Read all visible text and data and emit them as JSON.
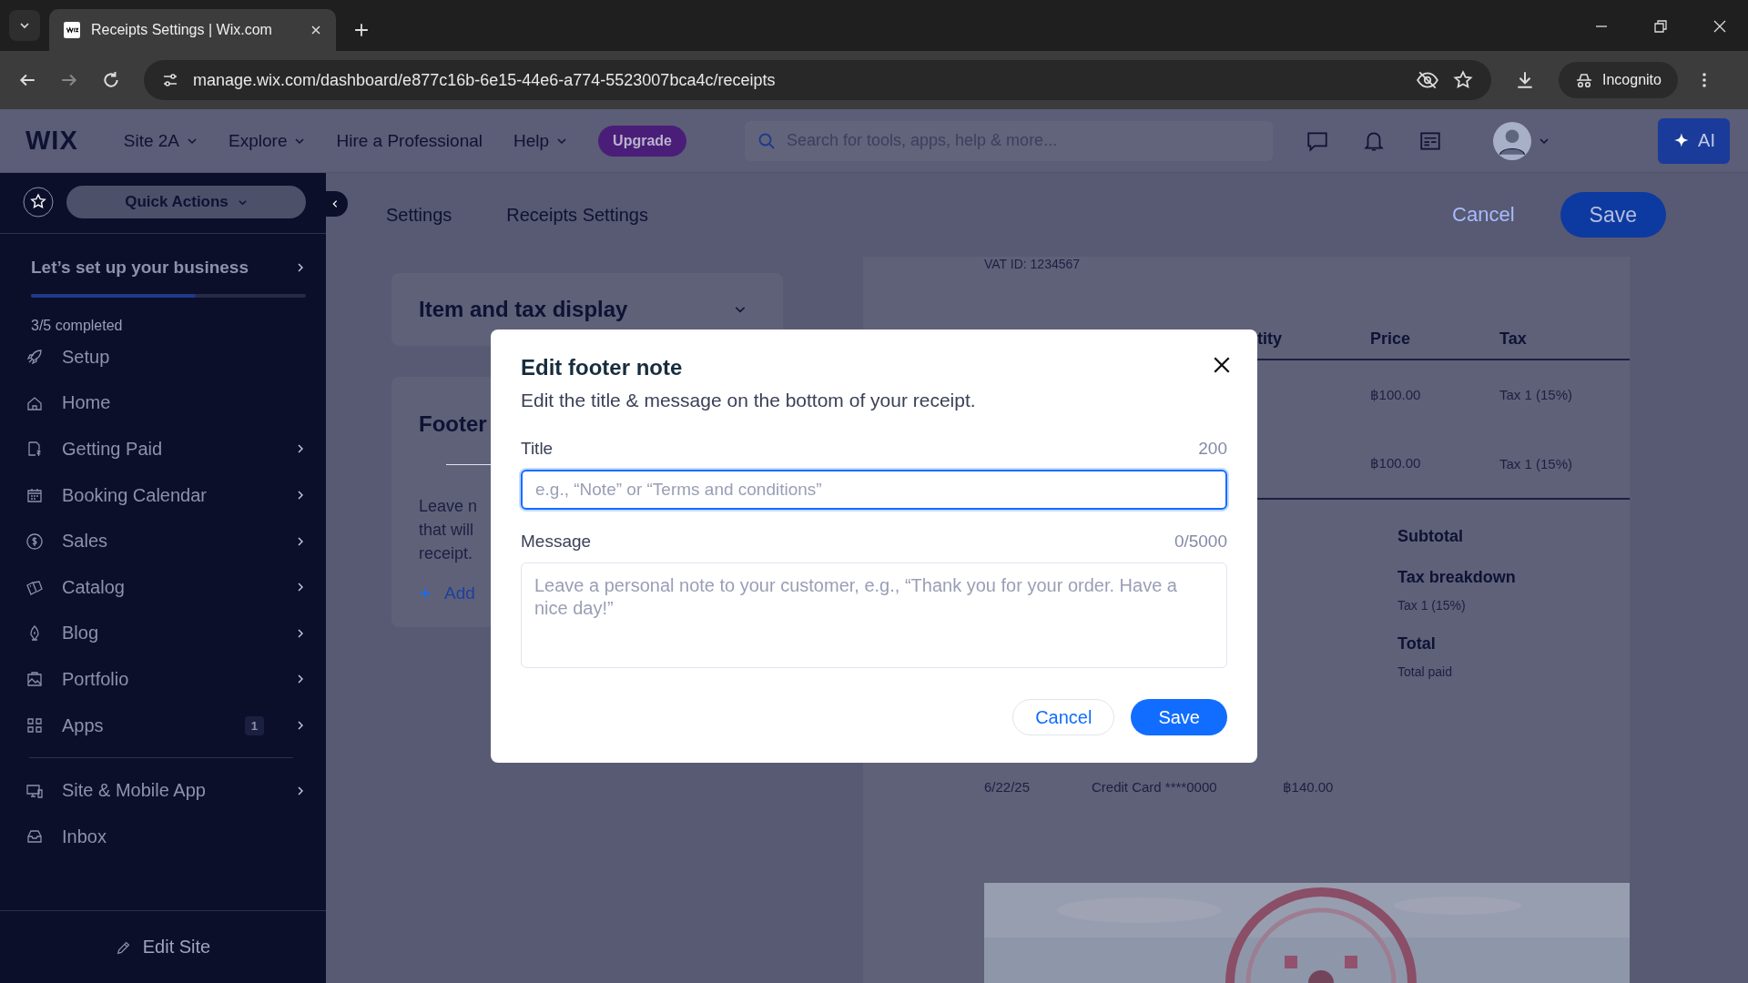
{
  "browser": {
    "tab_title": "Receipts Settings | Wix.com",
    "url": "manage.wix.com/dashboard/e877c16b-6e15-44e6-a774-5523007bca4c/receipts",
    "profile": "Incognito"
  },
  "topbar": {
    "logo": "WIX",
    "menus": [
      {
        "label": "Site 2A",
        "dropdown": true
      },
      {
        "label": "Explore",
        "dropdown": true
      },
      {
        "label": "Hire a Professional",
        "dropdown": false
      },
      {
        "label": "Help",
        "dropdown": true
      }
    ],
    "upgrade": "Upgrade",
    "search": {
      "placeholder": "Search for tools, apps, help & more..."
    },
    "ai": "AI"
  },
  "sidebar": {
    "quick_actions": "Quick Actions",
    "setup": {
      "title": "Let’s set up your business",
      "level": 0.6,
      "progress": "3/5 completed"
    },
    "items": [
      {
        "label": "Setup",
        "arrow": false
      },
      {
        "label": "Home",
        "arrow": false
      },
      {
        "label": "Getting Paid",
        "arrow": true
      },
      {
        "label": "Booking Calendar",
        "arrow": true
      },
      {
        "label": "Sales",
        "arrow": true
      },
      {
        "label": "Catalog",
        "arrow": true
      },
      {
        "label": "Blog",
        "arrow": true
      },
      {
        "label": "Portfolio",
        "arrow": true
      },
      {
        "label": "Apps",
        "arrow": true,
        "badge": "1"
      }
    ],
    "items_secondary": [
      {
        "label": "Site & Mobile App",
        "arrow": true
      },
      {
        "label": "Inbox",
        "arrow": false
      }
    ],
    "edit_site": "Edit Site"
  },
  "page": {
    "breadcrumbs": [
      "Settings",
      "Receipts Settings"
    ],
    "cancel": "Cancel",
    "save": "Save",
    "sections": [
      {
        "title": "Item and tax display"
      }
    ],
    "footer_card": {
      "title": "Footer",
      "lines": [
        "Leave n",
        "that will",
        "receipt."
      ],
      "add": "Add"
    }
  },
  "preview": {
    "vat": "VAT ID: 1234567",
    "columns": [
      "tity",
      "Price",
      "Tax"
    ],
    "rows": [
      {
        "price": "฿100.00",
        "tax": "Tax 1 (15%)"
      },
      {
        "price": "฿100.00",
        "tax": "Tax 1 (15%)"
      }
    ],
    "summary": [
      {
        "label": "Subtotal",
        "kind": "heading"
      },
      {
        "label": "Tax breakdown",
        "kind": "heading"
      },
      {
        "label": "Tax 1 (15%)",
        "kind": "detail"
      },
      {
        "label": "Total",
        "kind": "heading"
      },
      {
        "label": "Total paid",
        "kind": "detail"
      }
    ],
    "payment": [
      "6/22/25",
      "Credit Card ****0000",
      "฿140.00"
    ]
  },
  "modal": {
    "title": "Edit footer note",
    "subtitle": "Edit the title & message on the bottom of your receipt.",
    "fields": [
      {
        "label": "Title",
        "counter": "200",
        "placeholder": "e.g., “Note” or “Terms and conditions”",
        "kind": "input",
        "focused": true
      },
      {
        "label": "Message",
        "counter": "0/5000",
        "placeholder": "Leave a personal note to your customer, e.g., “Thank you for your order. Have a nice day!”",
        "kind": "textarea",
        "focused": false
      }
    ],
    "cancel": "Cancel",
    "save": "Save"
  }
}
